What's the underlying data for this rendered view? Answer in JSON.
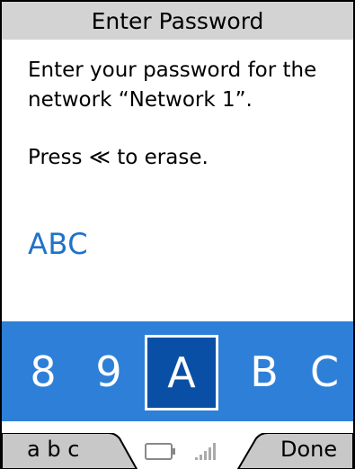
{
  "window": {
    "title": "Enter Password"
  },
  "message": {
    "line1": "Enter your password for the",
    "line2": "network “Network 1”."
  },
  "hint": "Press ≪ to erase.",
  "entered_text": "ABC",
  "picker": {
    "chars_before": [
      "8",
      "9"
    ],
    "selected": "A",
    "chars_after": [
      "B",
      "C"
    ]
  },
  "softkeys": {
    "left_label": "a b c",
    "right_label": "Done"
  },
  "icons": [
    "battery-icon",
    "signal-icon"
  ],
  "colors": {
    "title_bar": "#d3d3d3",
    "picker_bg": "#2e7fd8",
    "picker_selected": "#0a4fa6",
    "entered_text": "#1f72c9",
    "softkey_bg": "#c8c8c8"
  }
}
